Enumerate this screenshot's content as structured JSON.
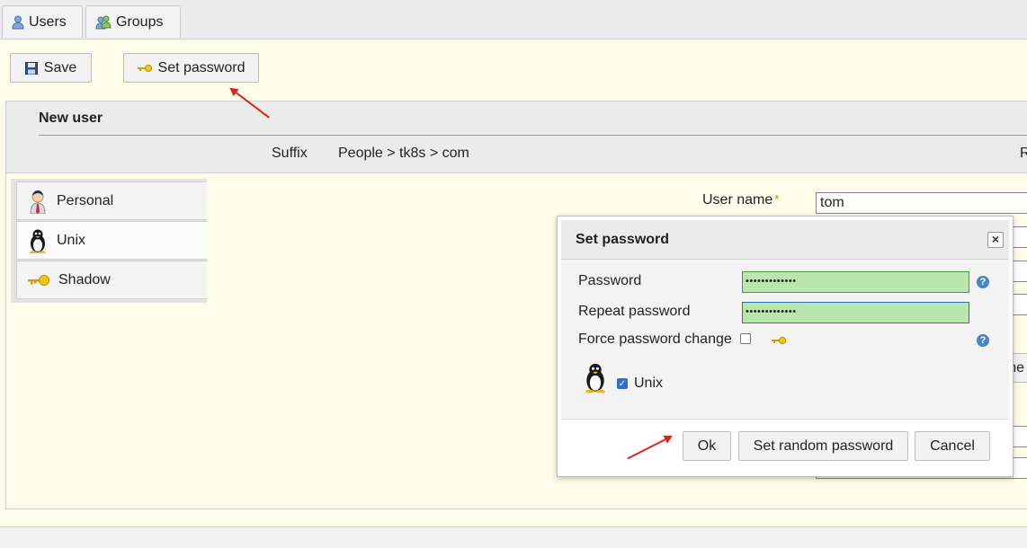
{
  "tabs": [
    {
      "label": "Users",
      "icon": "user-icon"
    },
    {
      "label": "Groups",
      "icon": "groups-icon"
    }
  ],
  "toolbar": {
    "save_label": "Save",
    "set_password_label": "Set password"
  },
  "panel": {
    "title": "New user",
    "suffix_label": "Suffix",
    "suffix_value": "People > tk8s > com",
    "cut_label": "R"
  },
  "side_tabs": [
    {
      "label": "Personal",
      "icon": "person-icon"
    },
    {
      "label": "Unix",
      "icon": "tux-icon"
    },
    {
      "label": "Shadow",
      "icon": "key-icon"
    }
  ],
  "form": {
    "username_label": "User name",
    "username_value": "tom",
    "required_mark": "*",
    "hidden_button_fragment": "ne"
  },
  "dialog": {
    "title": "Set password",
    "close_glyph": "×",
    "password_label": "Password",
    "password_value": "•••••••••••••",
    "repeat_label": "Repeat password",
    "repeat_value": "•••••••••••••",
    "force_label": "Force password change",
    "force_checked": false,
    "unix_label": "Unix",
    "unix_checked": true,
    "help_glyph": "?",
    "ok_label": "Ok",
    "random_label": "Set random password",
    "cancel_label": "Cancel"
  },
  "colors": {
    "annotation_arrow": "#e02020",
    "password_ok_fill": "#b8e6ad",
    "help_icon": "#4b83c6"
  }
}
